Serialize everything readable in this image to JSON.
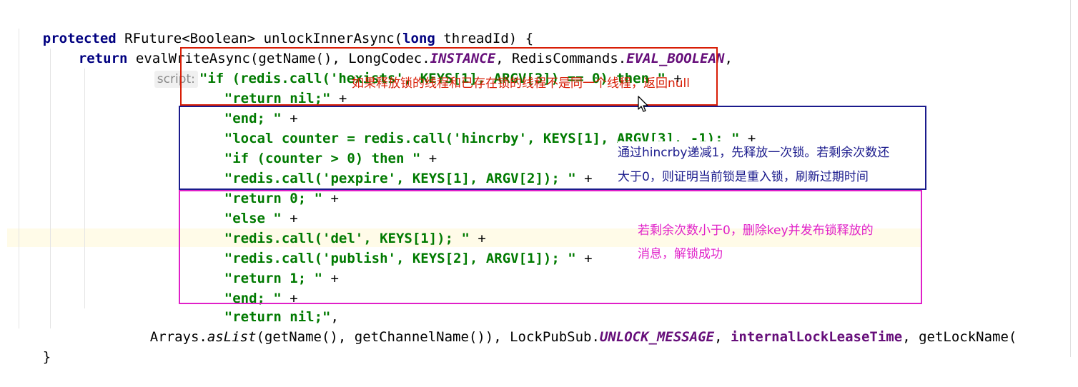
{
  "code": {
    "line1": {
      "kw_protected": "protected",
      "sig_rest": " RFuture<Boolean> unlockInnerAsync(",
      "kw_long": "long",
      "sig_end": " threadId) {"
    },
    "line2": {
      "kw_return": "return",
      "call_start": " evalWriteAsync(getName(), LongCodec.",
      "instance": "INSTANCE",
      "mid": ", RedisCommands.",
      "eval_boolean": "EVAL_BOOLEAN",
      "end": ","
    },
    "param_hint": "script:",
    "script_lines": [
      {
        "str": "\"if (redis.call('hexists', KEYS[1], ARGV[3]) == 0) then \"",
        "op": " +"
      },
      {
        "str": "\"return nil;\"",
        "op": " +"
      },
      {
        "str": "\"end; \"",
        "op": " +"
      },
      {
        "str": "\"local counter = redis.call('hincrby', KEYS[1], ARGV[3], -1); \"",
        "op": " +"
      },
      {
        "str": "\"if (counter > 0) then \"",
        "op": " +"
      },
      {
        "str": "\"redis.call('pexpire', KEYS[1], ARGV[2]); \"",
        "op": " +"
      },
      {
        "str": "\"return 0; \"",
        "op": " +"
      },
      {
        "str": "\"else \"",
        "op": " +"
      },
      {
        "str": "\"redis.call('del', KEYS[1]); \"",
        "op": " +"
      },
      {
        "str": "\"redis.call('publish', KEYS[2], ARGV[1]); \"",
        "op": " +"
      },
      {
        "str": "\"return 1; \"",
        "op": " +"
      },
      {
        "str": "\"end; \"",
        "op": " +"
      },
      {
        "str": "\"return nil;\"",
        "op": ","
      }
    ],
    "args_line": {
      "start": "Arrays.",
      "aslist": "asList",
      "mid": "(getName(), getChannelName()), LockPubSub.",
      "unlock_message": "UNLOCK_MESSAGE",
      "sep": ", ",
      "lease": "internalLockLeaseTime",
      "end": ", getLockName("
    },
    "closing_brace": "}"
  },
  "annotations": {
    "red": "如果释放锁的线程和已存在锁的线程不是同一个线程，返回null",
    "blue_line1": "通过hincrby递减1，先释放一次锁。若剩余次数还",
    "blue_line2": "大于0，则证明当前锁是重入锁，刷新过期时间",
    "magenta_line1": "若剩余次数小于0，删除key并发布锁释放的",
    "magenta_line2": "消息，解锁成功"
  },
  "colors": {
    "red_box": "#d81e06",
    "blue_box": "#1a1a8c",
    "magenta_box": "#e020c8",
    "string_green": "#007a00",
    "keyword_navy": "#000080",
    "constant_purple": "#660e7a"
  },
  "icons": {
    "cursor": "mouse-pointer-icon"
  }
}
